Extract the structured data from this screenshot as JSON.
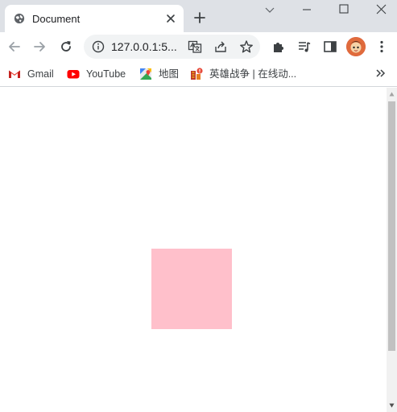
{
  "tab": {
    "title": "Document",
    "favicon": "globe-icon",
    "close_icon": "close-icon",
    "new_tab_icon": "plus-icon"
  },
  "window_controls": [
    "chevron-down-icon",
    "minimize-icon",
    "maximize-icon",
    "close-icon"
  ],
  "toolbar": {
    "url": "127.0.0.1:5...",
    "icons": [
      "back-icon",
      "forward-icon",
      "reload-icon",
      "info-icon",
      "translate-icon",
      "share-icon",
      "star-icon",
      "extensions-icon",
      "media-icon",
      "side-panel-icon",
      "avatar",
      "menu-icon"
    ]
  },
  "bookmarks": [
    {
      "label": "Gmail",
      "icon": "gmail-icon"
    },
    {
      "label": "YouTube",
      "icon": "youtube-icon"
    },
    {
      "label": "地图",
      "icon": "maps-icon"
    },
    {
      "label": "英雄战争 | 在线动...",
      "icon": "game-icon"
    }
  ],
  "bookmarks_more_icon": "double-chevron-right-icon",
  "content": {
    "box_color": "#ffc0cb"
  },
  "colors": {
    "tabstrip": "#dee1e6",
    "omnibox": "#f1f3f4",
    "scrollbar_track": "#f1f1f1",
    "scrollbar_thumb": "#c1c1c1"
  }
}
